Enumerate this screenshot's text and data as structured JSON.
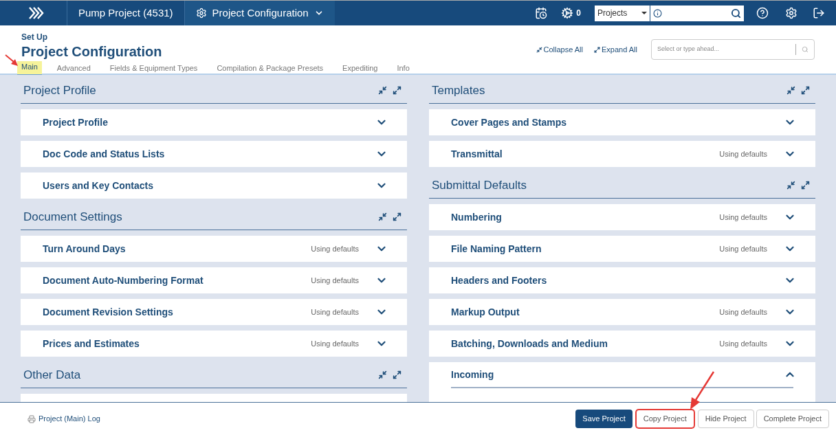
{
  "nav": {
    "breadcrumbs": [
      {
        "label": "Pump Project (4531)",
        "kind": "link"
      },
      {
        "label": "Project Configuration",
        "kind": "dropdown"
      }
    ],
    "jobs_count": "0",
    "search": {
      "scope": "Projects"
    }
  },
  "header": {
    "eyebrow": "Set Up",
    "title": "Project Configuration",
    "tabs": [
      {
        "label": "Main",
        "selected": true
      },
      {
        "label": "Advanced",
        "selected": false
      },
      {
        "label": "Fields & Equipment Types",
        "selected": false
      },
      {
        "label": "Compilation & Package Presets",
        "selected": false
      },
      {
        "label": "Expediting",
        "selected": false
      },
      {
        "label": "Info",
        "selected": false
      }
    ],
    "collapse_all": "Collapse All",
    "expand_all": "Expand All",
    "search": {
      "placeholder": "Select or type ahead..."
    }
  },
  "columns": [
    {
      "sections": [
        {
          "title": "Project Profile",
          "items": [
            {
              "label": "Project Profile",
              "expanded": false
            },
            {
              "label": "Doc Code and Status Lists",
              "expanded": false
            },
            {
              "label": "Users and Key Contacts",
              "expanded": false
            }
          ]
        },
        {
          "title": "Document Settings",
          "items": [
            {
              "label": "Turn Around Days",
              "status": "Using defaults",
              "expanded": false
            },
            {
              "label": "Document Auto-Numbering Format",
              "status": "Using defaults",
              "expanded": false
            },
            {
              "label": "Document Revision Settings",
              "status": "Using defaults",
              "expanded": false
            },
            {
              "label": "Prices and Estimates",
              "status": "Using defaults",
              "expanded": false
            }
          ]
        },
        {
          "title": "Other Data",
          "partial_card": true
        }
      ]
    },
    {
      "sections": [
        {
          "title": "Templates",
          "items": [
            {
              "label": "Cover Pages and Stamps",
              "expanded": false
            },
            {
              "label": "Transmittal",
              "status": "Using defaults",
              "expanded": false
            }
          ]
        },
        {
          "title": "Submittal Defaults",
          "items": [
            {
              "label": "Numbering",
              "status": "Using defaults",
              "expanded": false
            },
            {
              "label": "File Naming Pattern",
              "status": "Using defaults",
              "expanded": false
            },
            {
              "label": "Headers and Footers",
              "expanded": false
            },
            {
              "label": "Markup Output",
              "status": "Using defaults",
              "expanded": false
            },
            {
              "label": "Batching, Downloads and Medium",
              "status": "Using defaults",
              "expanded": false
            },
            {
              "label": "Incoming",
              "expanded": true
            }
          ]
        }
      ]
    }
  ],
  "footer": {
    "log_link": "Project (Main) Log",
    "buttons": [
      {
        "label": "Save Project",
        "kind": "primary",
        "highlighted": false
      },
      {
        "label": "Copy Project",
        "kind": "default",
        "highlighted": true
      },
      {
        "label": "Hide Project",
        "kind": "default",
        "highlighted": false
      },
      {
        "label": "Complete Project",
        "kind": "default",
        "highlighted": false
      }
    ]
  }
}
